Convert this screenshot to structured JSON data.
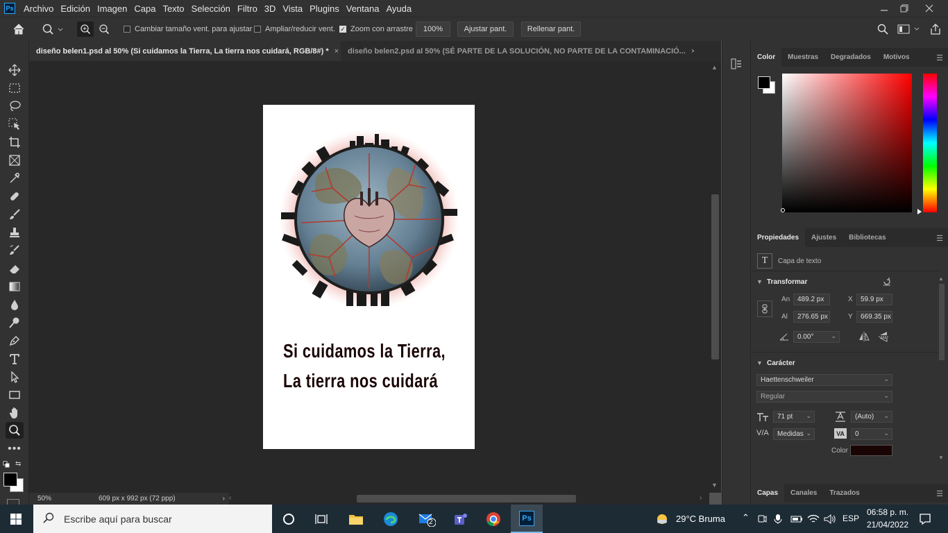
{
  "app": {
    "logo": "Ps"
  },
  "menu": [
    "Archivo",
    "Edición",
    "Imagen",
    "Capa",
    "Texto",
    "Selección",
    "Filtro",
    "3D",
    "Vista",
    "Plugins",
    "Ventana",
    "Ayuda"
  ],
  "options": {
    "checkbox_resize": {
      "label": "Cambiar tamaño vent. para ajustar",
      "checked": false
    },
    "checkbox_zoom_all": {
      "label": "Ampliar/reducir vent.",
      "checked": false
    },
    "checkbox_scrubby": {
      "label": "Zoom con arrastre",
      "checked": true
    },
    "zoom_value": "100%",
    "fit_label": "Ajustar pant.",
    "fill_label": "Rellenar pant."
  },
  "tabs": [
    {
      "label": "diseño belen1.psd al 50% (Si cuidamos la Tierra, La tierra nos cuidará, RGB/8#) *",
      "active": true
    },
    {
      "label": "diseño belen2.psd al 50% (SÉ PARTE DE LA SOLUCIÓN, NO PARTE DE LA CONTAMINACIÓ...",
      "active": false
    }
  ],
  "canvas": {
    "line1": "Si cuidamos la Tierra,",
    "line2": "La tierra nos cuidará"
  },
  "status": {
    "zoom": "50%",
    "doc_size": "609 px x 992 px (72 ppp)"
  },
  "color_panel": {
    "tabs": [
      "Color",
      "Muestras",
      "Degradados",
      "Motivos"
    ],
    "hue_color": "#ff0000"
  },
  "properties_panel": {
    "tabs": [
      "Propiedades",
      "Ajustes",
      "Bibliotecas"
    ],
    "layer_type": "Capa de texto",
    "transform_title": "Transformar",
    "width_label": "An",
    "width_value": "489.2 px",
    "height_label": "Al",
    "height_value": "276.65 px",
    "x_label": "X",
    "x_value": "59.9 px",
    "y_label": "Y",
    "y_value": "669.35 px",
    "angle_value": "0.00°",
    "character_title": "Carácter",
    "font_family": "Haettenschweiler",
    "font_style": "Regular",
    "font_size": "71 pt",
    "leading": "(Auto)",
    "kerning": "Medidas",
    "tracking": "0",
    "color_label": "Color",
    "text_color": "#1a0505"
  },
  "layers_panel": {
    "tabs": [
      "Capas",
      "Canales",
      "Trazados"
    ]
  },
  "taskbar": {
    "search_placeholder": "Escribe aquí para buscar",
    "weather": "29°C  Bruma",
    "lang": "ESP",
    "time": "06:58 p. m.",
    "date": "21/04/2022",
    "mail_badge": "2"
  }
}
